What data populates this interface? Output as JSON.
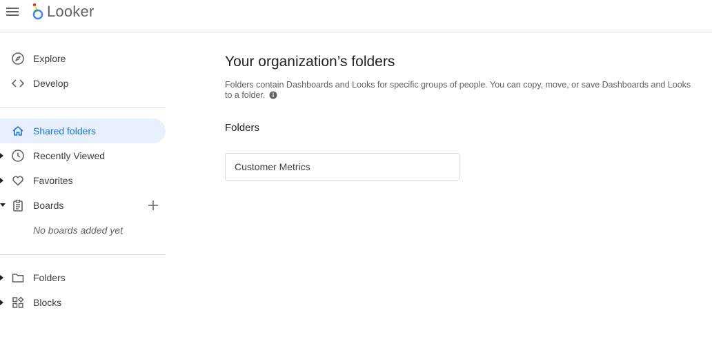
{
  "header": {
    "app_name": "Looker",
    "logo_colors": [
      "#4285F4",
      "#EA4335",
      "#FBBC04",
      "#34A853"
    ]
  },
  "sidebar": {
    "top_items": [
      {
        "label": "Explore",
        "icon": "compass-icon"
      },
      {
        "label": "Develop",
        "icon": "code-icon"
      }
    ],
    "main_items": [
      {
        "label": "Shared folders",
        "icon": "home-icon",
        "active": true
      },
      {
        "label": "Recently Viewed",
        "icon": "clock-icon"
      },
      {
        "label": "Favorites",
        "icon": "heart-icon"
      },
      {
        "label": "Boards",
        "icon": "clipboard-icon",
        "expanded": true
      }
    ],
    "boards_empty_text": "No boards added yet",
    "bottom_items": [
      {
        "label": "Folders",
        "icon": "folder-icon"
      },
      {
        "label": "Blocks",
        "icon": "blocks-icon"
      }
    ]
  },
  "main": {
    "title": "Your organization’s folders",
    "description": "Folders contain Dashboards and Looks for specific groups of people. You can copy, move, or save Dashboards and Looks to a folder.",
    "section_title": "Folders",
    "folders": [
      "Customer Metrics"
    ]
  },
  "colors": {
    "accent": "#1a73e8",
    "active_bg": "#e8f0fe",
    "divider": "#dadce0",
    "text": "#3c4043"
  }
}
